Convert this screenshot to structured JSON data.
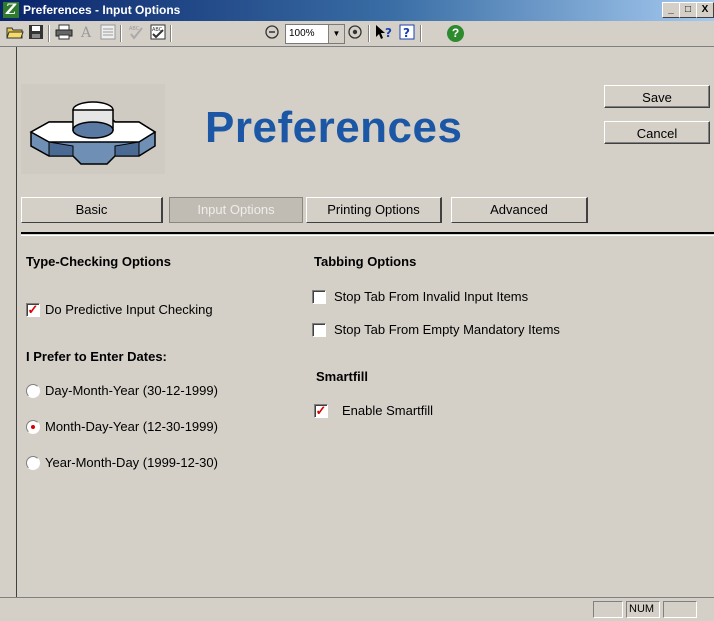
{
  "window": {
    "title": "Preferences - Input Options",
    "minimize_glyph": "_",
    "maximize_glyph": "□",
    "close_glyph": "X"
  },
  "toolbar": {
    "icons": [
      "open-folder-icon",
      "save-disk-icon",
      "print-icon",
      "font-icon",
      "format-icon",
      "spellcheck-icon",
      "abc-spell-icon",
      "zoom-out-icon",
      "zoom-in-icon",
      "whats-this-help-icon",
      "help-topics-icon",
      "green-help-icon"
    ],
    "zoom": "100%"
  },
  "header": {
    "title": "Preferences"
  },
  "buttons": {
    "save": "Save",
    "cancel": "Cancel"
  },
  "tabs": [
    {
      "label": "Basic",
      "active": false
    },
    {
      "label": "Input Options",
      "active": true
    },
    {
      "label": "Printing Options",
      "active": false
    },
    {
      "label": "Advanced",
      "active": false
    }
  ],
  "type_checking": {
    "title": "Type-Checking Options",
    "predictive": {
      "label": "Do Predictive Input Checking",
      "checked": true
    }
  },
  "dates": {
    "title": "I Prefer to Enter Dates:",
    "options": [
      {
        "label": "Day-Month-Year (30-12-1999)",
        "selected": false
      },
      {
        "label": "Month-Day-Year (12-30-1999)",
        "selected": true
      },
      {
        "label": "Year-Month-Day (1999-12-30)",
        "selected": false
      }
    ]
  },
  "tabbing": {
    "title": "Tabbing Options",
    "options": [
      {
        "label": "Stop Tab From Invalid Input Items",
        "checked": false
      },
      {
        "label": "Stop Tab From Empty Mandatory Items",
        "checked": false
      }
    ]
  },
  "smartfill": {
    "title": "Smartfill",
    "enable": {
      "label": "Enable Smartfill",
      "checked": true
    }
  },
  "statusbar": {
    "num": "NUM"
  },
  "colors": {
    "heading": "#1c57a6",
    "check": "#dd0000",
    "face": "#d4d0c8"
  }
}
